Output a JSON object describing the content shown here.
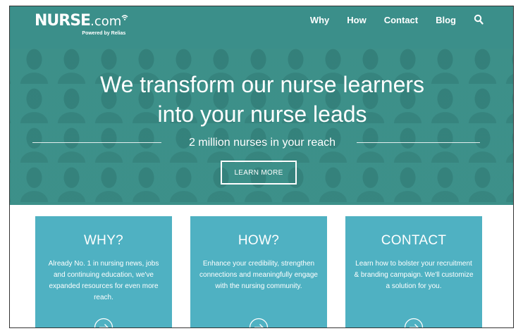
{
  "header": {
    "logo_main": "NURSE",
    "logo_suffix": ".com",
    "logo_sub": "Powered by Relias",
    "nav": [
      "Why",
      "How",
      "Contact",
      "Blog"
    ],
    "search_icon": "search-icon"
  },
  "hero": {
    "title_line1": "We transform our nurse learners",
    "title_line2": "into your nurse leads",
    "subtitle": "2 million nurses in your reach",
    "button_label": "LEARN MORE"
  },
  "cards": [
    {
      "title": "WHY?",
      "text": "Already No. 1 in nursing news, jobs and continuing education, we've expanded resources for even more reach."
    },
    {
      "title": "HOW?",
      "text": "Enhance your credibility, strengthen connections and meaningfully engage with the nursing community."
    },
    {
      "title": "CONTACT",
      "text": "Learn how to bolster your recruitment & branding campaign. We'll customize a solution for you."
    }
  ],
  "colors": {
    "header_bg": "#3b8f8a",
    "hero_bg": "#3d8f89",
    "card_bg": "#4fb1c2"
  }
}
